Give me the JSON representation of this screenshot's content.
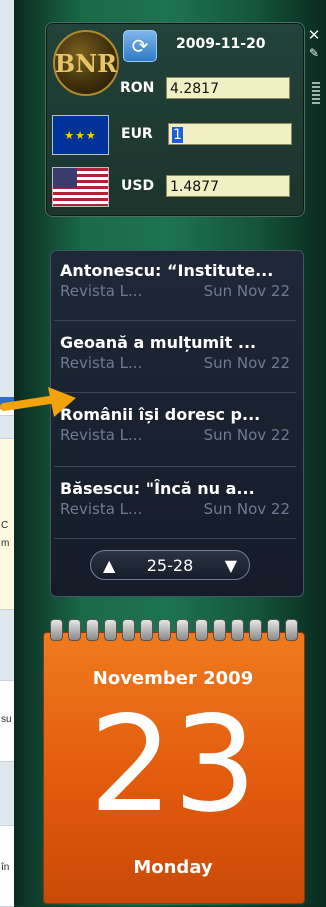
{
  "background_fragments": [
    "C",
    "m",
    "su",
    "în"
  ],
  "currency": {
    "date": "2009-11-20",
    "refresh_icon": "refresh-icon",
    "rows": [
      {
        "code": "RON",
        "value": "4.2817"
      },
      {
        "code": "EUR",
        "value": "1"
      },
      {
        "code": "USD",
        "value": "1.4877"
      }
    ],
    "logo_text": "BNR"
  },
  "tools": {
    "close_icon": "✕",
    "wrench_icon": "🔧"
  },
  "news": {
    "items": [
      {
        "title": "Antonescu: “Institute...",
        "source": "Revista L...",
        "date": "Sun Nov 22"
      },
      {
        "title": "Geoană a mulțumit ...",
        "source": "Revista L...",
        "date": "Sun Nov 22"
      },
      {
        "title": "Românii își doresc p...",
        "source": "Revista L...",
        "date": "Sun Nov 22"
      },
      {
        "title": "Băsescu: \"Încă nu a...",
        "source": "Revista L...",
        "date": "Sun Nov 22"
      }
    ],
    "pager": {
      "range": "25-28",
      "prev": "▲",
      "next": "▼"
    }
  },
  "calendar": {
    "month_year": "November 2009",
    "day": "23",
    "weekday": "Monday"
  },
  "colors": {
    "accent_orange": "#e8640f",
    "arrow": "#f2a20a",
    "news_bg": "#1a2130"
  }
}
